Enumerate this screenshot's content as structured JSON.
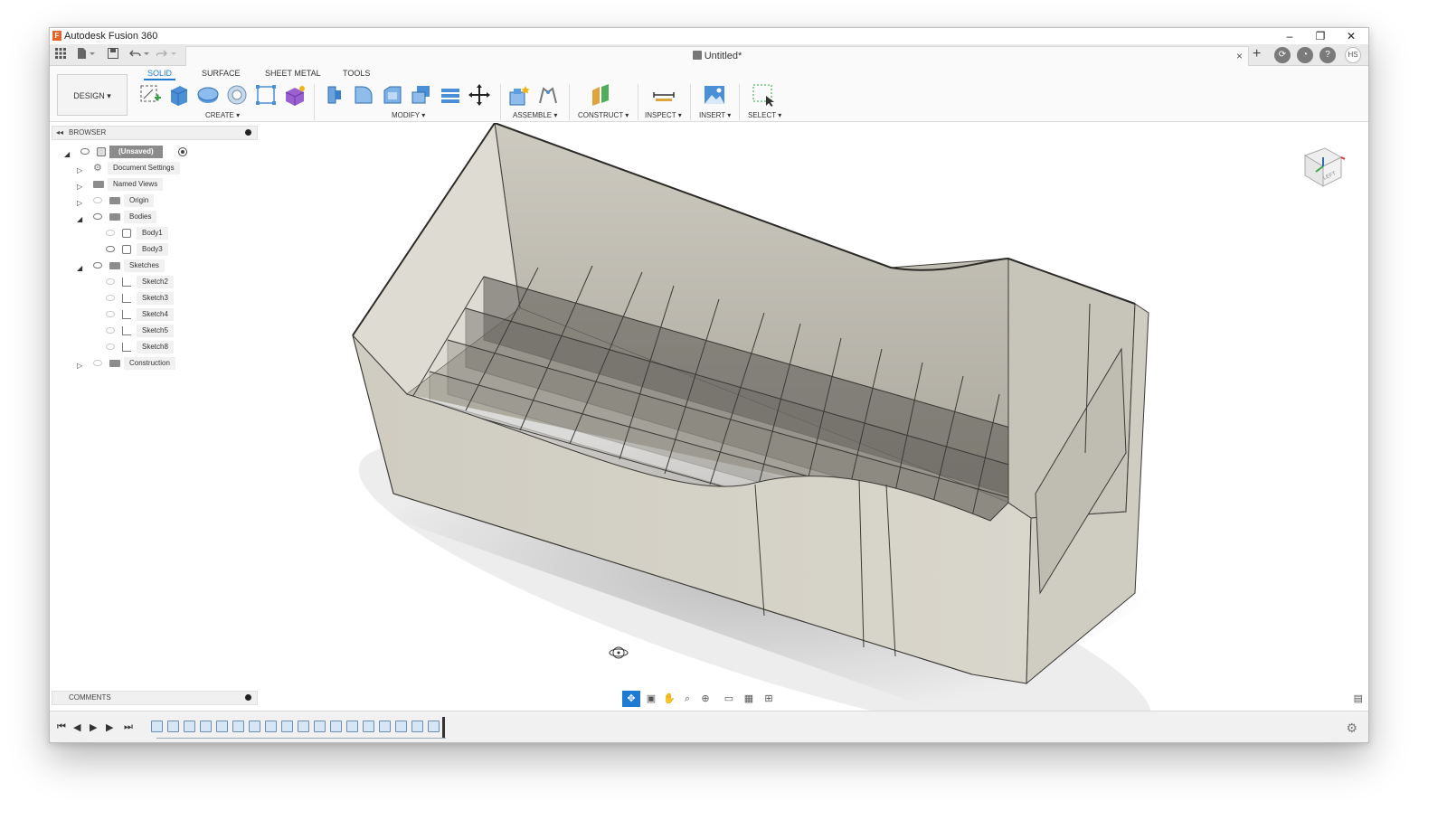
{
  "window": {
    "title": "Autodesk Fusion 360",
    "logo_letter": "F",
    "controls": {
      "minimize": "–",
      "restore": "❐",
      "close": "✕"
    }
  },
  "appbar": {
    "doc_title": "Untitled*",
    "close_tab": "×",
    "add_tab": "+",
    "user_initials": "HS"
  },
  "toolbar": {
    "workspace": "DESIGN ▾",
    "tabs": [
      "SOLID",
      "SURFACE",
      "SHEET METAL",
      "TOOLS"
    ],
    "active_tab": "SOLID",
    "groups": [
      "CREATE ▾",
      "MODIFY ▾",
      "ASSEMBLE ▾",
      "CONSTRUCT ▾",
      "INSPECT ▾",
      "INSERT ▾",
      "SELECT ▾"
    ]
  },
  "browser": {
    "header": "BROWSER",
    "items": [
      {
        "label": "(Unsaved)",
        "kind": "root"
      },
      {
        "label": "Document Settings",
        "kind": "settings"
      },
      {
        "label": "Named Views",
        "kind": "folder"
      },
      {
        "label": "Origin",
        "kind": "folder"
      },
      {
        "label": "Bodies",
        "kind": "folder"
      },
      {
        "label": "Body1",
        "kind": "body"
      },
      {
        "label": "Body3",
        "kind": "body"
      },
      {
        "label": "Sketches",
        "kind": "folder"
      },
      {
        "label": "Sketch2",
        "kind": "sketch"
      },
      {
        "label": "Sketch3",
        "kind": "sketch"
      },
      {
        "label": "Sketch4",
        "kind": "sketch"
      },
      {
        "label": "Sketch5",
        "kind": "sketch"
      },
      {
        "label": "Sketch8",
        "kind": "sketch"
      },
      {
        "label": "Construction",
        "kind": "folder"
      }
    ]
  },
  "comments": {
    "header": "COMMENTS"
  },
  "viewcube": {
    "face_label": "LEFT"
  },
  "colors": {
    "accent": "#1d7bd1",
    "model": "#d6d3c8",
    "model_dark": "#3b3a36"
  }
}
